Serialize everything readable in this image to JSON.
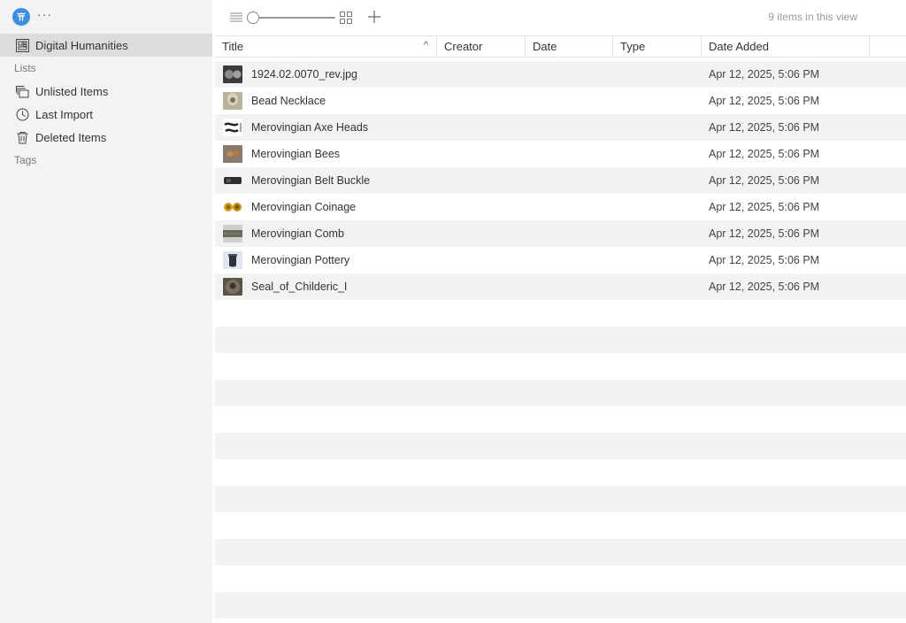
{
  "sidebar": {
    "more_glyph": "···",
    "library": {
      "label": "Digital Humanities",
      "icon": "library-grid-icon"
    },
    "lists_header": "Lists",
    "lists": [
      {
        "label": "Unlisted Items",
        "icon": "unlisted-items-icon"
      },
      {
        "label": "Last Import",
        "icon": "clock-icon"
      },
      {
        "label": "Deleted Items",
        "icon": "trash-icon"
      }
    ],
    "tags_header": "Tags"
  },
  "toolbar": {
    "item_count": "9 items in this view",
    "plus_glyph": "+",
    "zoom_level": 0.0
  },
  "table": {
    "columns": [
      "Title",
      "Creator",
      "Date",
      "Type",
      "Date Added"
    ],
    "sort_glyph": "^",
    "rows": [
      {
        "title": "1924.02.0070_rev.jpg",
        "creator": "",
        "date": "",
        "type": "",
        "date_added": "Apr 12, 2025, 5:06 PM"
      },
      {
        "title": "Bead Necklace",
        "creator": "",
        "date": "",
        "type": "",
        "date_added": "Apr 12, 2025, 5:06 PM"
      },
      {
        "title": "Merovingian Axe Heads",
        "creator": "",
        "date": "",
        "type": "",
        "date_added": "Apr 12, 2025, 5:06 PM"
      },
      {
        "title": "Merovingian Bees",
        "creator": "",
        "date": "",
        "type": "",
        "date_added": "Apr 12, 2025, 5:06 PM"
      },
      {
        "title": "Merovingian Belt Buckle",
        "creator": "",
        "date": "",
        "type": "",
        "date_added": "Apr 12, 2025, 5:06 PM"
      },
      {
        "title": "Merovingian Coinage",
        "creator": "",
        "date": "",
        "type": "",
        "date_added": "Apr 12, 2025, 5:06 PM"
      },
      {
        "title": "Merovingian Comb",
        "creator": "",
        "date": "",
        "type": "",
        "date_added": "Apr 12, 2025, 5:06 PM"
      },
      {
        "title": "Merovingian Pottery",
        "creator": "",
        "date": "",
        "type": "",
        "date_added": "Apr 12, 2025, 5:06 PM"
      },
      {
        "title": "Seal_of_Childeric_I",
        "creator": "",
        "date": "",
        "type": "",
        "date_added": "Apr 12, 2025, 5:06 PM"
      }
    ]
  },
  "colors": {
    "accent": "#3c8fe0",
    "sidebar_bg": "#f3f3f3",
    "selected_bg": "#dcdcdc",
    "stripe": "#f2f2f2"
  }
}
